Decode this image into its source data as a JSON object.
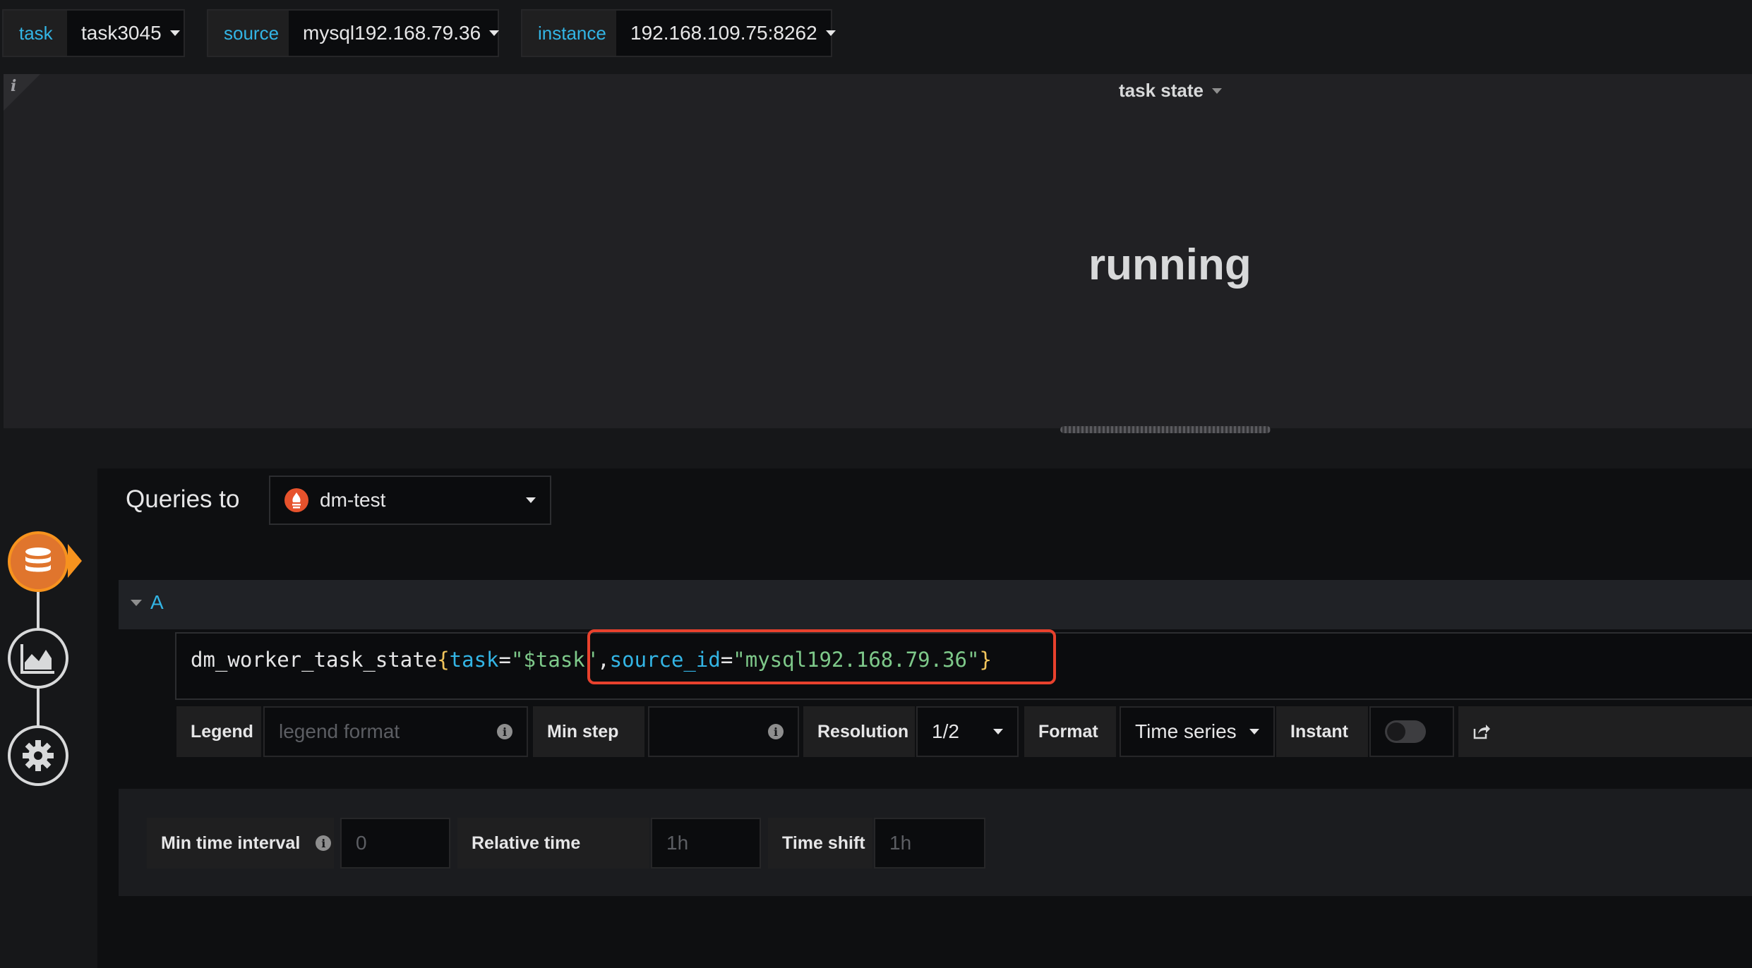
{
  "variables": [
    {
      "label": "task",
      "value": "task3045"
    },
    {
      "label": "source",
      "value": "mysql192.168.79.36"
    },
    {
      "label": "instance",
      "value": "192.168.109.75:8262"
    }
  ],
  "panel": {
    "info_icon": "i",
    "title": "task state",
    "stat_value": "running"
  },
  "editor": {
    "queries_to_label": "Queries to",
    "datasource": "dm-test",
    "steps": [
      "database-icon",
      "chart-icon",
      "settings-icon"
    ],
    "query": {
      "letter": "A",
      "metric": "dm_worker_task_state",
      "brace_open": "{",
      "label1": "task",
      "eq1": "=",
      "value1": "\"$task\"",
      "comma": ",",
      "label2": "source_id",
      "eq2": "=",
      "value2": "\"mysql192.168.79.36\"",
      "brace_close": "}"
    },
    "options": {
      "legend_label": "Legend",
      "legend_placeholder": "legend format",
      "min_step_label": "Min step",
      "min_step_value": "",
      "resolution_label": "Resolution",
      "resolution_value": "1/2",
      "format_label": "Format",
      "format_value": "Time series",
      "instant_label": "Instant",
      "instant_on": false
    },
    "bottom": {
      "min_time_interval_label": "Min time interval",
      "min_time_interval_placeholder": "0",
      "relative_time_label": "Relative time",
      "relative_time_placeholder": "1h",
      "time_shift_label": "Time shift",
      "time_shift_placeholder": "1h"
    }
  },
  "colors": {
    "accent_blue": "#33b5e5",
    "active_step": "#f7931e",
    "highlight": "#e8412d",
    "string": "#7ec98a",
    "brace": "#f2c55c"
  }
}
